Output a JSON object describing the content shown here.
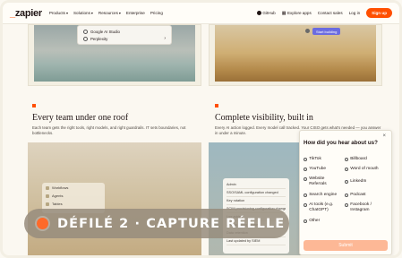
{
  "nav": {
    "logo": "zapier",
    "links": [
      "Products",
      "Solutions",
      "Resources",
      "Enterprise",
      "Pricing"
    ],
    "github": "GitHub",
    "explore_apps": "Explore apps",
    "contact_sales": "Contact sales",
    "login": "Log in",
    "signup": "Sign up"
  },
  "top_left_menu": {
    "items": [
      "Google AI Studio",
      "Perplexity"
    ]
  },
  "top_right": {
    "assist_button": "Start building"
  },
  "section_left": {
    "heading": "Every team under one roof",
    "body": "Each team gets the right tools, right models, and right guardrails. IT sets boundaries, not bottlenecks.",
    "panel_items": [
      "Workflows",
      "Agents",
      "Tables"
    ]
  },
  "section_right": {
    "heading": "Complete visibility, built in",
    "body": "Every AI action logged. Every model call tracked. Your CISO gets what's needed — you answer in under a minute.",
    "log_rows": [
      "Admin",
      "SSO/SAML configuration changed",
      "Key rotation",
      "SCIM provisioning configuration changed",
      "Log added",
      "Access policy updated",
      "Data retention",
      "Last updated by SIEM"
    ]
  },
  "survey": {
    "question": "How did you hear about us?",
    "options_left": [
      "TikTok",
      "YouTube",
      "Website Referrals",
      "Search engine",
      "AI tools (e.g. ChatGPT)",
      "Other"
    ],
    "options_right": [
      "Billboard",
      "Word of mouth",
      "LinkedIn",
      "Podcast",
      "Facebook / Instagram"
    ],
    "submit": "Submit"
  },
  "overlay": {
    "label": "DÉFILÉ 2 · CAPTURE RÉELLE"
  },
  "colors": {
    "brand": "#ff4f00",
    "background": "#fbf8f1",
    "submit_disabled": "#fdb896"
  }
}
